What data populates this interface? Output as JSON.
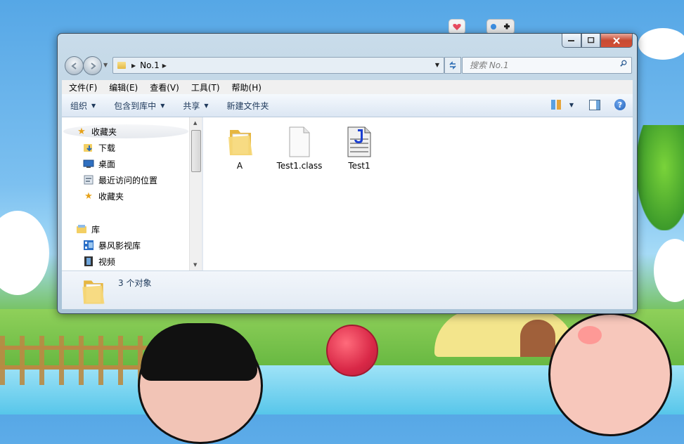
{
  "window": {
    "address_path": [
      "No.1"
    ],
    "search_placeholder": "搜索 No.1"
  },
  "menubar": {
    "items": [
      "文件(F)",
      "编辑(E)",
      "查看(V)",
      "工具(T)",
      "帮助(H)"
    ]
  },
  "toolbar": {
    "organize": "组织",
    "include_library": "包含到库中",
    "share": "共享",
    "new_folder": "新建文件夹"
  },
  "nav_pane": {
    "favorites_header": "收藏夹",
    "favorites": [
      "下载",
      "桌面",
      "最近访问的位置",
      "收藏夹"
    ],
    "libraries_header": "库",
    "libraries": [
      "暴风影视库",
      "视频"
    ]
  },
  "files": [
    {
      "name": "A",
      "icon": "folder-icon"
    },
    {
      "name": "Test1.class",
      "icon": "blank-file-icon"
    },
    {
      "name": "Test1",
      "icon": "java-file-icon"
    }
  ],
  "status": {
    "count_text": "3 个对象"
  },
  "colors": {
    "toolbar_text": "#1e395b",
    "close_button": "#c74a32",
    "accent_blue": "#2b6cb3"
  }
}
